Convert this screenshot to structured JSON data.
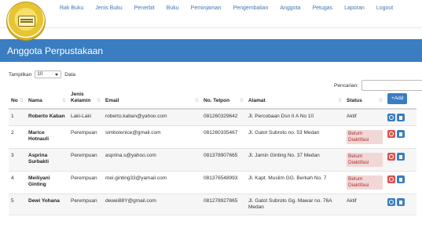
{
  "nav": [
    "Rak Buku",
    "Jenis Buku",
    "Penerbit",
    "Buku",
    "Peminjaman",
    "Pengembalian",
    "Anggota",
    "Petugas",
    "Laporan",
    "Logout"
  ],
  "page": {
    "title": "Anggota Perpustakaan"
  },
  "controls": {
    "show_label": "Tampilkan",
    "show_value": "10",
    "show_suffix": "Data",
    "search_label": "Pencarian:"
  },
  "table": {
    "headers": [
      "No",
      "Nama",
      "Jenis Kelamin",
      "Email",
      "No. Telpon",
      "Alamat",
      "Status"
    ],
    "add_label": "+Add",
    "rows": [
      {
        "no": "1",
        "nama": "Roberto Kaban",
        "jk": "Laki-Laki",
        "email": "roberto.kaban@yahoo.com",
        "telp": "081260329642",
        "alamat": "Jl. Percobaan Dsn II A No 10",
        "status": "Aktif",
        "active": true
      },
      {
        "no": "2",
        "nama": "Marice Hotnauli",
        "jk": "Perempuan",
        "email": "simbolonice@gmail.com",
        "telp": "081260335467",
        "alamat": "Jl. Gatot Subroto no. 53 Medan",
        "status": "Belum Diaktifasi",
        "active": false
      },
      {
        "no": "3",
        "nama": "Asprina Surbakti",
        "jk": "Perempuan",
        "email": "asprina.s@yahoo.com",
        "telp": "081378907665",
        "alamat": "Jl. Jamin Ginting No. 37 Medan",
        "status": "Belum Diaktifasi",
        "active": false
      },
      {
        "no": "4",
        "nama": "Meiliyani Ginting",
        "jk": "Perempuan",
        "email": "mei.ginting33@yamail.com",
        "telp": "081376548993",
        "alamat": "Jl. Kapt. Muslim GG. Berkah No. 7",
        "status": "Belum Diaktifasi",
        "active": false
      },
      {
        "no": "5",
        "nama": "Dewi Yohana",
        "jk": "Perempuan",
        "email": "dewei88Y@gmail.com",
        "telp": "081278927865",
        "alamat": "Jl. Gatot Subroto Gg. Mawar no. 76A Medan",
        "status": "Aktif",
        "active": true
      }
    ]
  }
}
